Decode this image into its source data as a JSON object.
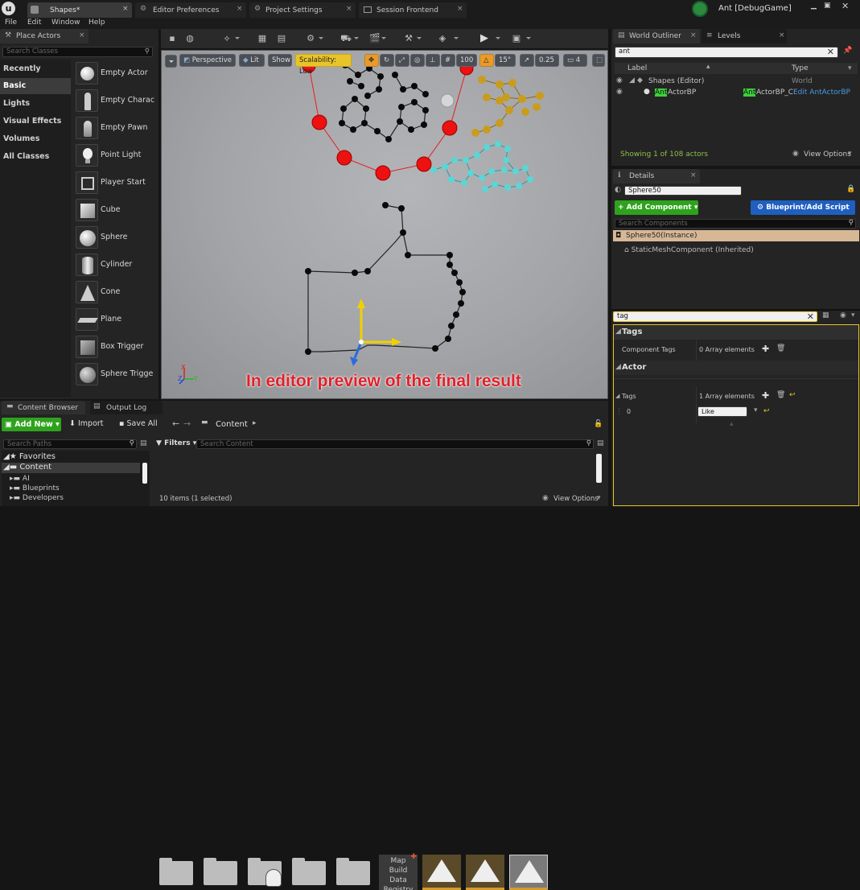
{
  "window": {
    "tabs": [
      {
        "label": "Shapes*"
      },
      {
        "label": "Editor Preferences"
      },
      {
        "label": "Project Settings"
      },
      {
        "label": "Session Frontend"
      }
    ],
    "title": "Ant [DebugGame]"
  },
  "menu": [
    "File",
    "Edit",
    "Window",
    "Help"
  ],
  "place_actors": {
    "tab": "Place Actors",
    "search_placeholder": "Search Classes",
    "categories": [
      "Recently Placed",
      "Basic",
      "Lights",
      "Visual Effects",
      "Volumes",
      "All Classes"
    ],
    "items": [
      "Empty Actor",
      "Empty Charac",
      "Empty Pawn",
      "Point Light",
      "Player Start",
      "Cube",
      "Sphere",
      "Cylinder",
      "Cone",
      "Plane",
      "Box Trigger",
      "Sphere Trigge"
    ]
  },
  "viewport": {
    "view_mode": "Perspective",
    "lit": "Lit",
    "show": "Show",
    "scalability": "Scalability: Low",
    "grid_snap": "100",
    "rotation_snap": "15°",
    "scale_snap": "0.25",
    "camera_speed": "4",
    "caption": "In editor preview of the final result",
    "axis_x": "X",
    "axis_y": "Y",
    "axis_z": "Z"
  },
  "outliner": {
    "tabs": [
      "World Outliner",
      "Levels"
    ],
    "search_value": "ant",
    "col_label": "Label",
    "col_type": "Type",
    "rows": [
      {
        "label": "Shapes (Editor)",
        "type": "World"
      },
      {
        "label_hl": "Ant",
        "label_rest": "ActorBP",
        "type_hl": "Ant",
        "type_rest": "ActorBP_C",
        "type_link": "Edit AntActorBP"
      }
    ],
    "status": "Showing 1 of 108 actors",
    "view_options": "View Options"
  },
  "details": {
    "tab": "Details",
    "name_value": "Sphere50",
    "add_component": "+ Add Component",
    "blueprint_button": "Blueprint/Add Script",
    "search_components_placeholder": "Search Components",
    "instance_row": "Sphere50(Instance)",
    "component_row": "StaticMeshComponent (Inherited)",
    "filter_value": "tag",
    "sections": {
      "tags_header": "Tags",
      "component_tags_label": "Component Tags",
      "component_tags_value": "0 Array elements",
      "actor_header": "Actor",
      "tags_label": "Tags",
      "tags_value": "1 Array elements",
      "index_label": "0",
      "index_value": "Like"
    }
  },
  "content_browser": {
    "tabs": [
      "Content Browser",
      "Output Log"
    ],
    "add_new": "Add New",
    "import": "Import",
    "save_all": "Save All",
    "path": "Content",
    "search_paths_placeholder": "Search Paths",
    "filters": "Filters",
    "search_content_placeholder": "Search Content",
    "tree": [
      "Favorites",
      "Content",
      "AI",
      "Blueprints",
      "Developers"
    ],
    "map_build_text": [
      "Map",
      "Build",
      "Data",
      "Registry"
    ],
    "status": "10 items (1 selected)",
    "view_options": "View Options"
  },
  "colors": {
    "accent_green": "#2ea21d",
    "accent_blue": "#1f5fbf",
    "scalability_yellow": "#e8c42b",
    "highlight_green": "#3cd23c",
    "caption_red": "#e0202a"
  }
}
